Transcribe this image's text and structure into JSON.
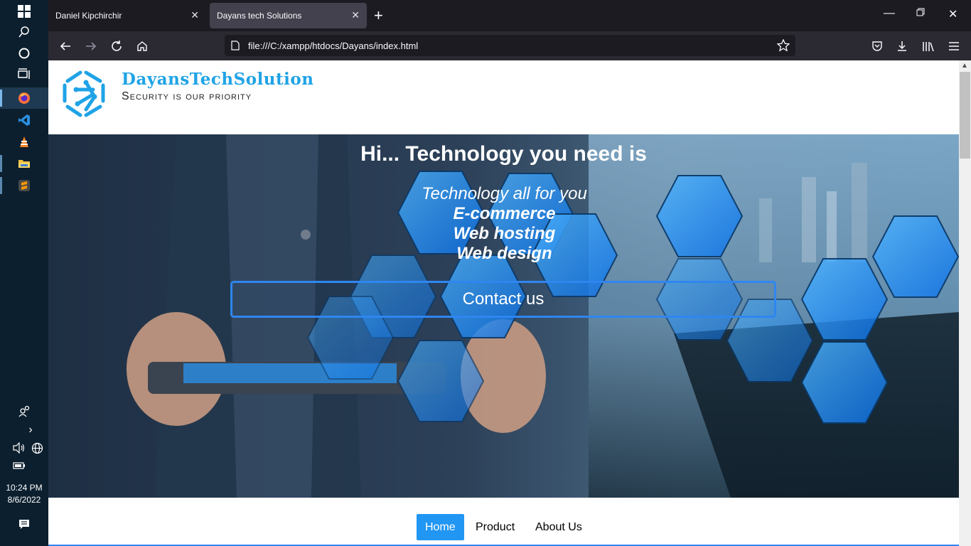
{
  "taskbar": {
    "time": "10:24 PM",
    "date": "8/6/2022"
  },
  "browser": {
    "tabs": [
      {
        "label": "Daniel Kipchirchir",
        "active": false
      },
      {
        "label": "Dayans tech Solutions",
        "active": true
      }
    ],
    "url": "file:///C:/xampp/htdocs/Dayans/index.html"
  },
  "page": {
    "brand": {
      "name": "DayansTechSolution",
      "tagline": "Security is our priority",
      "primary_color": "#1fa3e6"
    },
    "hero": {
      "title": "Hi... Technology you need is",
      "subtitle": "Technology all for you",
      "services": [
        "E-commerce",
        "Web hosting",
        "Web design"
      ],
      "contact_label": "Contact us"
    },
    "menu": {
      "items": [
        {
          "label": "Home",
          "active": true
        },
        {
          "label": "Product",
          "active": false
        },
        {
          "label": "About Us",
          "active": false
        }
      ],
      "accent": "#2196f3"
    }
  }
}
